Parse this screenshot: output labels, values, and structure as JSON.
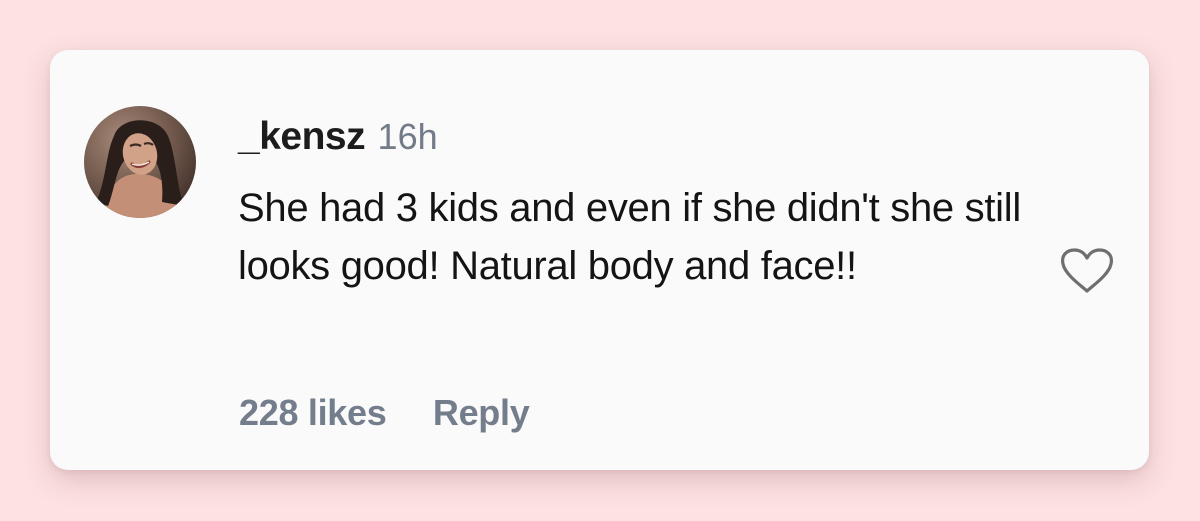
{
  "comment": {
    "username": "_kensz",
    "time": "16h",
    "text": "She had 3 kids and even if she didn't she still looks good! Natural body and face!!",
    "likes_label": "228 likes",
    "reply_label": "Reply",
    "avatar_icon": "user-avatar-photo",
    "like_icon": "heart-outline-icon"
  },
  "colors": {
    "page_background": "#fde2e3",
    "card_background": "#fafafa",
    "text_primary": "#141414",
    "text_secondary": "#747d8b"
  }
}
